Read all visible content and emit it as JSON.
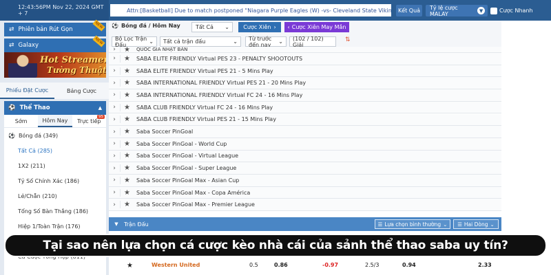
{
  "topbar": {
    "datetime": "12:43:56PM Nov 22, 2024 GMT + 7",
    "announcement": "Attn:[Basketball] Due to match postponed \"Niagara Purple Eagles (W) -vs- Cleveland State Vikings",
    "result_label": "Kết Quả",
    "odds_type": "Tỷ lệ cược MALAY",
    "quick_bet_label": "Cược Nhanh"
  },
  "sidebar": {
    "promo_1": "Phiên bản Rút Gọn",
    "promo_1_badge": "NEW",
    "promo_2": "Galaxy",
    "promo_2_badge": "NEW",
    "banner_line1": "Hot Streamer",
    "banner_line2": "Tường Thuật",
    "betslip_tabs": [
      "Phiếu Đặt Cược",
      "Bảng Cược"
    ],
    "sport_title": "Thể Thao",
    "time_tabs": [
      "Sớm",
      "Hôm Nay",
      "Trực tiếp"
    ],
    "live_count": "95",
    "menu": [
      "Bóng đá (349)",
      "Tất Cả (285)",
      "1X2 (211)",
      "Tỷ Số Chính Xác (186)",
      "Lẻ/Chẵn (210)",
      "Tổng Số Bàn Thắng (186)",
      "Hiệp 1/Toàn Trận (176)",
      "",
      "Cá Cược Tổng Hợp (811)"
    ]
  },
  "main": {
    "sport_label": "Bóng đá / Hôm Nay",
    "select_all": "Tất Cả",
    "parlay_label": "Cược Xiên",
    "lucky_parlay_label": "Cược Xiên May Mắn",
    "filters": [
      "Bộ Lọc Trận Đấu",
      "Tất cả trận đấu",
      "Từ trước đến nay",
      "(102 / 102) Giải"
    ],
    "leagues": [
      "QUỐC GIA NHẬT BẢN",
      "SABA ELITE FRIENDLY Virtual PES 23 - PENALTY SHOOTOUTS",
      "SABA ELITE FRIENDLY Virtual PES 21 - 5 Mins Play",
      "SABA INTERNATIONAL FRIENDLY Virtual PES 21 - 20 Mins Play",
      "SABA INTERNATIONAL FRIENDLY Virtual FC 24 - 16 Mins Play",
      "SABA CLUB FRIENDLY Virtual FC 24 - 16 Mins Play",
      "SABA CLUB FRIENDLY Virtual PES 21 - 15 Mins Play",
      "Saba Soccer PinGoal",
      "Saba Soccer PinGoal - World Cup",
      "Saba Soccer PinGoal - Virtual League",
      "Saba Soccer PinGoal - Super League",
      "Saba Soccer PinGoal Max - Asian Cup",
      "Saba Soccer PinGoal Max - Copa América",
      "Saba Soccer PinGoal Max - Premier League"
    ],
    "matches_header": "Trận Đấu",
    "sort_label": "Lựa chọn bình thường",
    "lines_label": "Hai Dòng",
    "match": {
      "team": "Western United",
      "odds": [
        "0.5",
        "0.86",
        "-0.97",
        "2.5/3",
        "0.94",
        "2.33"
      ]
    }
  },
  "caption": "Tại sao nên lựa chọn cá cược kèo nhà cái của sảnh thể thao saba uy tín?",
  "colors": {
    "primary": "#2b5d92",
    "accent_purple": "#7a3ad6",
    "header_blue": "#4a86c5"
  }
}
